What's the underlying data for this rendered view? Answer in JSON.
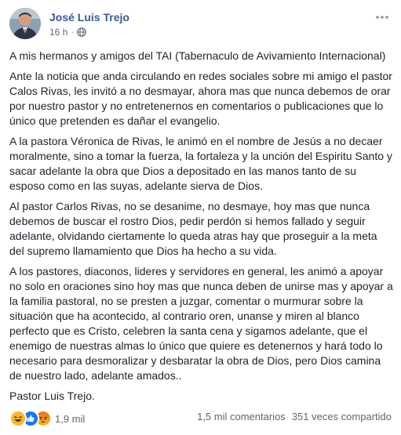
{
  "post": {
    "author": "José Luis Trejo",
    "time": "16 h",
    "separator": "·",
    "privacy_icon": "globe-icon",
    "paragraphs": [
      "A mis hermanos y amigos del TAI (Tabernaculo de Avivamiento Internacional)",
      "Ante la noticia que anda circulando en redes sociales sobre mi amigo el pastor Calos Rivas, les invitó a no desmayar, ahora mas que nunca debemos de orar por nuestro pastor y no entretenernos en comentarios o publicaciones que lo único que pretenden es dañar el evangelio.",
      "A la pastora Véronica de Rivas, le animó en el nombre de Jesús a no decaer moralmente, sino a tomar la fuerza, la fortaleza y la unción del Espiritu Santo y sacar adelante la obra que Dios a depositado en las manos tanto de su esposo como en las suyas, adelante sierva de Dios.",
      "Al pastor Carlos Rivas, no se desanime, no desmaye, hoy mas que nunca debemos de buscar el rostro Dios, pedir perdón si hemos fallado y seguir adelante, olvidando ciertamente lo queda atras hay que proseguir a la meta del supremo llamamiento que Dios ha hecho a su vida.",
      "A los pastores, diaconos, lideres y servidores en general, les animó a apoyar no solo en oraciones sino hoy mas que nunca deben de unirse mas y apoyar a la familia pastoral, no se presten a juzgar, comentar o murmurar sobre la situación que ha acontecido, al contrario oren, unanse y miren al blanco perfecto que es Cristo, celebren la santa cena y sigamos adelante, que el enemigo de nuestras almas lo único que quiere es detenernos y hará todo lo necesario para desmoralizar y desbaratar la obra de Dios, pero Dios camina de nuestro lado, adelante amados..",
      "Pastor Luis Trejo."
    ]
  },
  "footer": {
    "reactions": [
      "haha-icon",
      "like-icon",
      "angry-icon"
    ],
    "reaction_count": "1,9 mil",
    "comments": "1,5 mil comentarios",
    "shares": "351 veces compartido"
  },
  "colors": {
    "author": "#385898",
    "text": "#1d2129",
    "meta": "#616770",
    "like_blue": "#1877f2",
    "haha_yellow": "#f7b928",
    "angry_orange": "#e9710f"
  }
}
